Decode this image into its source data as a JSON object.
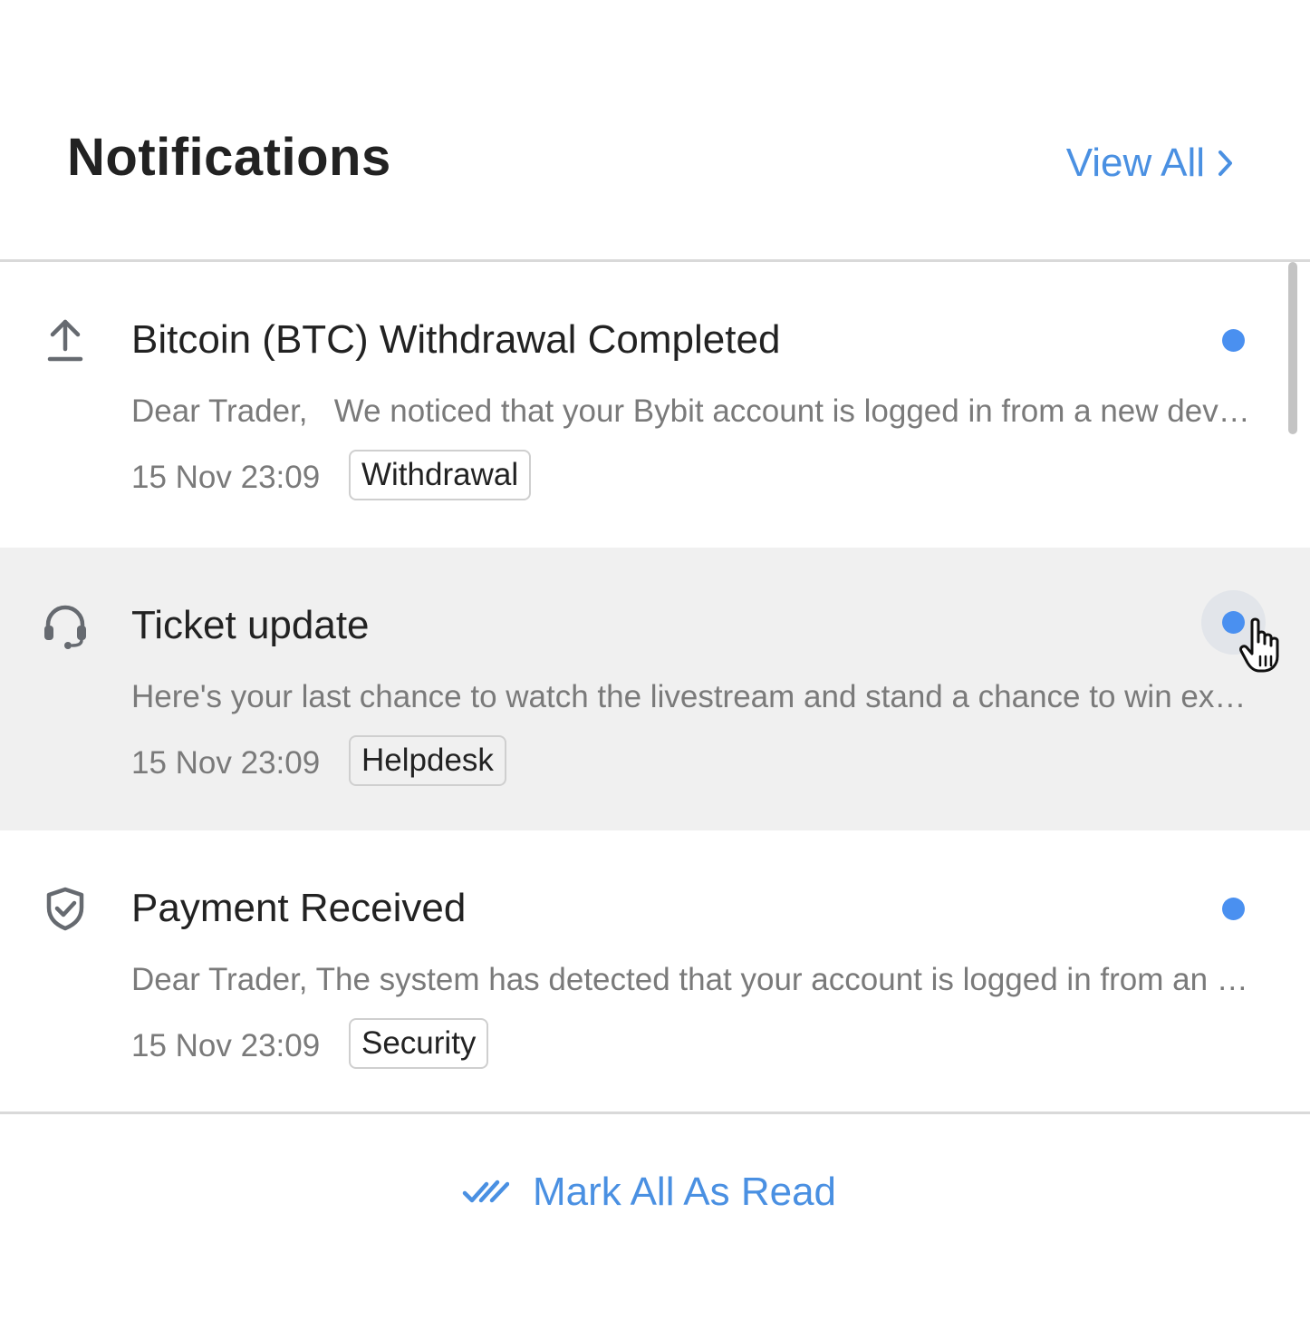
{
  "header": {
    "title": "Notifications",
    "view_all_label": "View All",
    "view_all_icon": "chevron-right-icon"
  },
  "notifications": [
    {
      "icon": "upload-arrow-icon",
      "title": "Bitcoin (BTC) Withdrawal Completed",
      "body": "Dear Trader,   We noticed that your Bybit account is logged in from a new device or location. If this is not you, please contact support.",
      "time": "15 Nov 23:09",
      "tag": "Withdrawal",
      "unread": true,
      "hovered": false
    },
    {
      "icon": "headset-icon",
      "title": "Ticket update",
      "body": "Here's your last chance to watch the livestream and stand a chance to win exclusive prizes.",
      "time": "15 Nov 23:09",
      "tag": "Helpdesk",
      "unread": true,
      "hovered": true
    },
    {
      "icon": "shield-check-icon",
      "title": "Payment Received",
      "body": "Dear Trader, The system has detected that your account is logged in from an unused IP address.",
      "time": "15 Nov 23:09",
      "tag": "Security",
      "unread": true,
      "hovered": false
    }
  ],
  "footer": {
    "mark_all_label": "Mark All As Read",
    "mark_all_icon": "double-check-icon"
  },
  "colors": {
    "accent": "#4a90e2",
    "unread_dot": "#4a90f0",
    "hover_bg": "#f0f0f0",
    "title_text": "#222222",
    "secondary_text": "#7a7a7a"
  }
}
